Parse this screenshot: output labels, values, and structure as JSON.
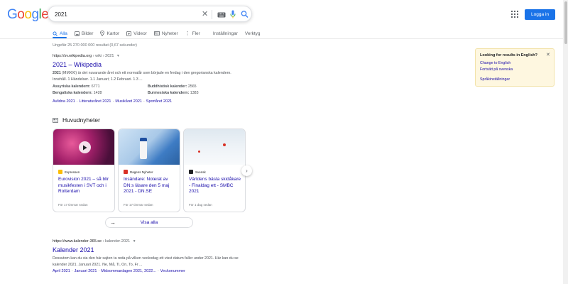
{
  "header": {
    "logo": "Google",
    "search_value": "2021",
    "login_label": "Logga in"
  },
  "tabs": [
    {
      "label": "Alla",
      "active": true
    },
    {
      "label": "Bilder"
    },
    {
      "label": "Kartor"
    },
    {
      "label": "Videor"
    },
    {
      "label": "Nyheter"
    },
    {
      "label": "Fler"
    },
    {
      "label": "Inställningar"
    },
    {
      "label": "Verktyg"
    }
  ],
  "stats": "Ungefär 25 270 000 000 resultat (0,67 sekunder)",
  "result1": {
    "url": "https://sv.wikipedia.org",
    "crumb": " › wiki › 2021",
    "title": "2021 – Wikipedia",
    "snippet_bold": "2021",
    "snippet_rest": " (MMXXI) är det nuvarande året och ett normalår som började en fredag i den gregorianska kalendern. Innehåll. 1 Händelser. 1.1 Januari; 1.2 Februari. 1.3 ...",
    "facts": [
      {
        "label": "Assyriska kalendern:",
        "value": " 6771"
      },
      {
        "label": "Buddhistisk kalender:",
        "value": " 2565"
      },
      {
        "label": "Bengaliska kalendern:",
        "value": " 1428"
      },
      {
        "label": "Burmesiska kalendern:",
        "value": " 1383"
      }
    ],
    "sitelinks": [
      "Avlidna 2021",
      "Litteraturåret 2021",
      "Musikåret 2021",
      "Sportåret 2021"
    ]
  },
  "top_stories": {
    "heading": "Huvudnyheter",
    "cards": [
      {
        "source": "Expressen",
        "title": "Eurovision 2021 – så blir musikfesten i SVT och i Rotterdam",
        "time": "För 17 timmar sedan"
      },
      {
        "source": "Dagens Nyheter",
        "title": "Insändare: Noterat av DN:s läsare den 5 maj 2021 - DN.SE",
        "time": "För 17 timmar sedan"
      },
      {
        "source": "Svensk",
        "title": "Världens bästa skidåkare - Finaldag ett - SMBC 2021",
        "time": "För 1 dag sedan"
      }
    ],
    "view_all": "Visa alla"
  },
  "result2": {
    "url": "https://www.kalender-365.se",
    "crumb": " › kalender-2021",
    "title": "Kalender 2021",
    "snippet": "Dessutom kan du via den här sajten ta reda på vilken veckodag ett visst datum faller under 2021. Här kan du se kalender 2021. Januari 2021. Ne, Må, Ti, On, To, Fr ...",
    "sitelinks": [
      "April 2021",
      "Januari 2021",
      "Midsommardagen 2021, 2022...",
      "Veckonummer"
    ]
  },
  "panel": {
    "heading": "Looking for results in English?",
    "link1": "Change to English",
    "link2": "Fortsätt på svenska",
    "link3": "Språkinställningar"
  }
}
